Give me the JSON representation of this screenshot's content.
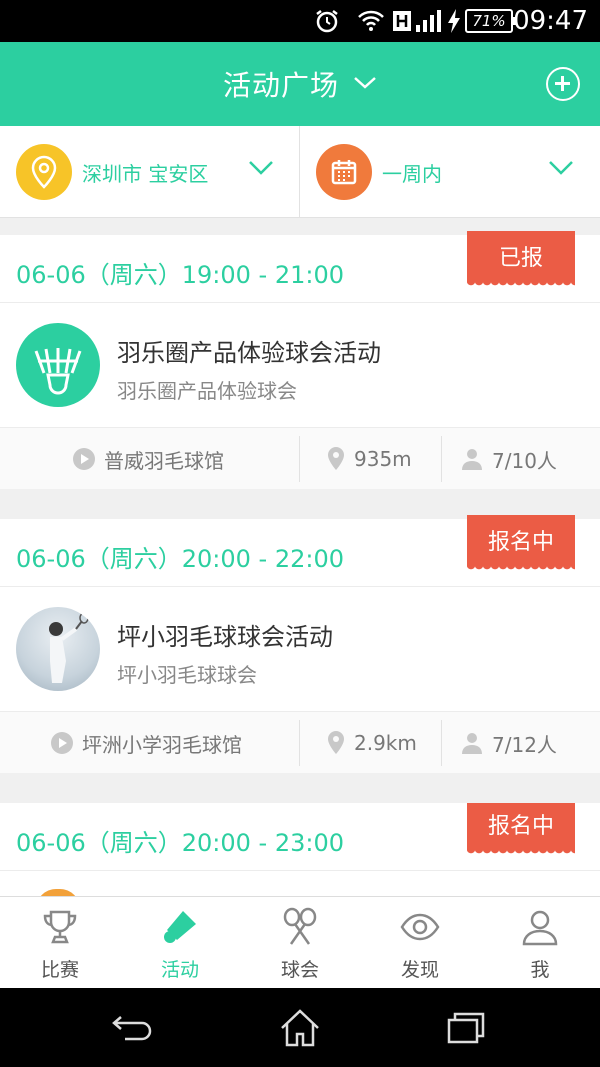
{
  "status_bar": {
    "battery": "71%",
    "time": "09:47"
  },
  "header": {
    "title": "活动广场"
  },
  "filters": {
    "location": "深圳市 宝安区",
    "date_range": "一周内"
  },
  "activities": [
    {
      "time": "06-06（周六）19:00 - 21:00",
      "status": "已报",
      "name": "羽乐圈产品体验球会活动",
      "club": "羽乐圈产品体验球会",
      "venue": "普威羽毛球馆",
      "distance": "935m",
      "participants": "7/10人"
    },
    {
      "time": "06-06（周六）20:00 - 22:00",
      "status": "报名中",
      "name": "坪小羽毛球球会活动",
      "club": "坪小羽毛球球会",
      "venue": "坪洲小学羽毛球馆",
      "distance": "2.9km",
      "participants": "7/12人"
    },
    {
      "time": "06-06（周六）20:00 - 23:00",
      "status": "报名中"
    }
  ],
  "tabs": [
    {
      "label": "比赛",
      "icon": "trophy-icon"
    },
    {
      "label": "活动",
      "icon": "shuttlecock-icon"
    },
    {
      "label": "球会",
      "icon": "rackets-icon"
    },
    {
      "label": "发现",
      "icon": "eye-icon"
    },
    {
      "label": "我",
      "icon": "person-icon"
    }
  ],
  "colors": {
    "accent": "#2ccfa0",
    "badge": "#eb5c45",
    "location_icon": "#f7c428",
    "calendar_icon": "#f07a3c"
  }
}
